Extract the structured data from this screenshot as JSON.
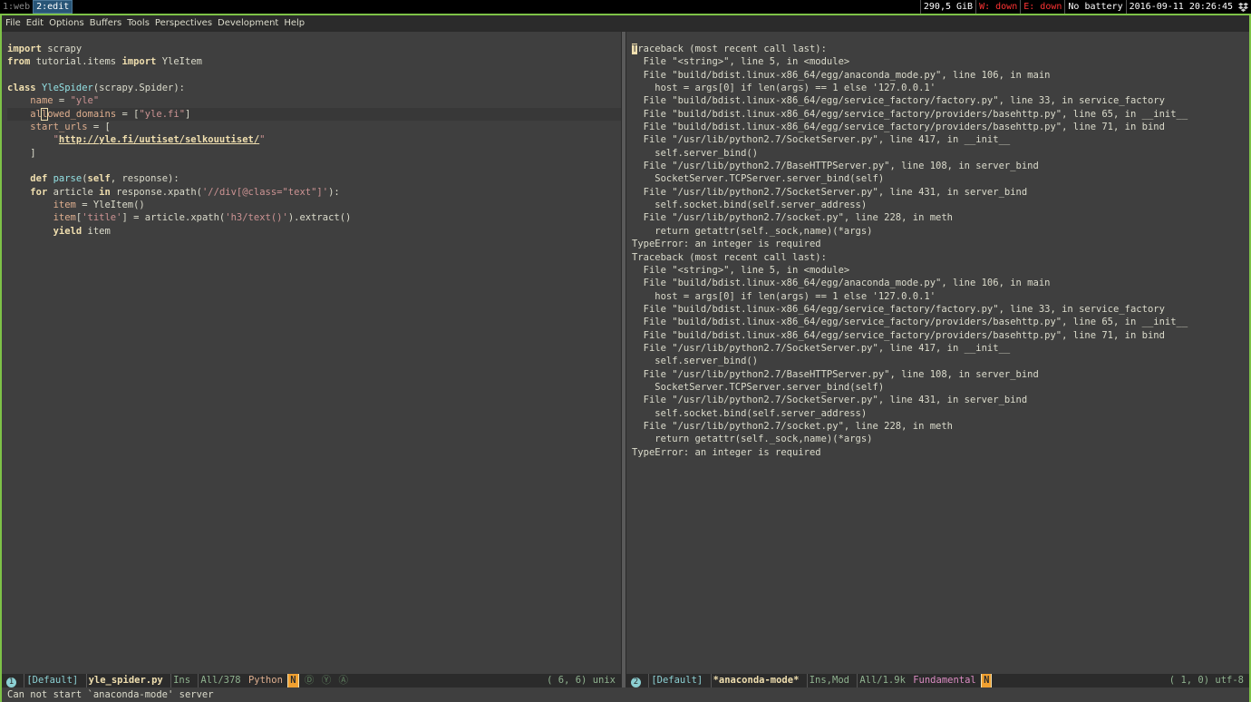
{
  "topbar": {
    "workspaces": [
      {
        "label": "1:web",
        "active": false
      },
      {
        "label": "2:edit",
        "active": true
      }
    ],
    "disk": "290,5 GiB",
    "wireless": "W: down",
    "ethernet": "E: down",
    "battery": "No battery",
    "datetime": "2016-09-11 20:26:45",
    "tray_icon": "dropbox-icon"
  },
  "menubar": {
    "items": [
      "File",
      "Edit",
      "Options",
      "Buffers",
      "Tools",
      "Perspectives",
      "Development",
      "Help"
    ]
  },
  "left_buffer": {
    "lines": [
      [
        {
          "t": "import",
          "c": "kw"
        },
        {
          "t": " scrapy"
        }
      ],
      [
        {
          "t": "from",
          "c": "kw"
        },
        {
          "t": " tutorial.items "
        },
        {
          "t": "import",
          "c": "kw"
        },
        {
          "t": " YleItem"
        }
      ],
      [
        {
          "t": ""
        }
      ],
      [
        {
          "t": "class",
          "c": "kw"
        },
        {
          "t": " "
        },
        {
          "t": "YleSpider",
          "c": "fn"
        },
        {
          "t": "(scrapy.Spider):"
        }
      ],
      [
        {
          "t": "    "
        },
        {
          "t": "name",
          "c": "var"
        },
        {
          "t": " = "
        },
        {
          "t": "\"yle\"",
          "c": "str"
        }
      ],
      [
        {
          "t": "    "
        },
        {
          "t": "al",
          "c": "var"
        },
        {
          "t": "l",
          "c": "var cursor"
        },
        {
          "t": "owed_domains",
          "c": "var"
        },
        {
          "t": " = ["
        },
        {
          "t": "\"yle.fi\"",
          "c": "str"
        },
        {
          "t": "]"
        }
      ],
      [
        {
          "t": "    "
        },
        {
          "t": "start_urls",
          "c": "var"
        },
        {
          "t": " = ["
        }
      ],
      [
        {
          "t": "        "
        },
        {
          "t": "\"",
          "c": "str"
        },
        {
          "t": "http://yle.fi/uutiset/selkouutiset/",
          "c": "url"
        },
        {
          "t": "\"",
          "c": "str"
        }
      ],
      [
        {
          "t": "    ]"
        }
      ],
      [
        {
          "t": ""
        }
      ],
      [
        {
          "t": "    "
        },
        {
          "t": "def",
          "c": "kw"
        },
        {
          "t": " "
        },
        {
          "t": "parse",
          "c": "fn"
        },
        {
          "t": "("
        },
        {
          "t": "self",
          "c": "self"
        },
        {
          "t": ", response):"
        }
      ],
      [
        {
          "t": "    "
        },
        {
          "t": "for",
          "c": "kw"
        },
        {
          "t": " article "
        },
        {
          "t": "in",
          "c": "kw"
        },
        {
          "t": " response.xpath("
        },
        {
          "t": "'//div[@class=\"text\"]'",
          "c": "str"
        },
        {
          "t": "):"
        }
      ],
      [
        {
          "t": "        "
        },
        {
          "t": "item",
          "c": "var"
        },
        {
          "t": " = YleItem()"
        }
      ],
      [
        {
          "t": "        "
        },
        {
          "t": "item",
          "c": "var"
        },
        {
          "t": "["
        },
        {
          "t": "'title'",
          "c": "str"
        },
        {
          "t": "] = article.xpath("
        },
        {
          "t": "'h3/text()'",
          "c": "str"
        },
        {
          "t": ").extract()"
        }
      ],
      [
        {
          "t": "        "
        },
        {
          "t": "yield",
          "c": "kw"
        },
        {
          "t": " item"
        }
      ]
    ],
    "highlight_line": 5
  },
  "right_buffer": {
    "lines": [
      "Traceback (most recent call last):",
      "  File \"<string>\", line 5, in <module>",
      "  File \"build/bdist.linux-x86_64/egg/anaconda_mode.py\", line 106, in main",
      "    host = args[0] if len(args) == 1 else '127.0.0.1'",
      "  File \"build/bdist.linux-x86_64/egg/service_factory/factory.py\", line 33, in service_factory",
      "  File \"build/bdist.linux-x86_64/egg/service_factory/providers/basehttp.py\", line 65, in __init__",
      "  File \"build/bdist.linux-x86_64/egg/service_factory/providers/basehttp.py\", line 71, in bind",
      "  File \"/usr/lib/python2.7/SocketServer.py\", line 417, in __init__",
      "    self.server_bind()",
      "  File \"/usr/lib/python2.7/BaseHTTPServer.py\", line 108, in server_bind",
      "    SocketServer.TCPServer.server_bind(self)",
      "  File \"/usr/lib/python2.7/SocketServer.py\", line 431, in server_bind",
      "    self.socket.bind(self.server_address)",
      "  File \"/usr/lib/python2.7/socket.py\", line 228, in meth",
      "    return getattr(self._sock,name)(*args)",
      "TypeError: an integer is required",
      "Traceback (most recent call last):",
      "  File \"<string>\", line 5, in <module>",
      "  File \"build/bdist.linux-x86_64/egg/anaconda_mode.py\", line 106, in main",
      "    host = args[0] if len(args) == 1 else '127.0.0.1'",
      "  File \"build/bdist.linux-x86_64/egg/service_factory/factory.py\", line 33, in service_factory",
      "  File \"build/bdist.linux-x86_64/egg/service_factory/providers/basehttp.py\", line 65, in __init__",
      "  File \"build/bdist.linux-x86_64/egg/service_factory/providers/basehttp.py\", line 71, in bind",
      "  File \"/usr/lib/python2.7/SocketServer.py\", line 417, in __init__",
      "    self.server_bind()",
      "  File \"/usr/lib/python2.7/BaseHTTPServer.py\", line 108, in server_bind",
      "    SocketServer.TCPServer.server_bind(self)",
      "  File \"/usr/lib/python2.7/SocketServer.py\", line 431, in server_bind",
      "    self.socket.bind(self.server_address)",
      "  File \"/usr/lib/python2.7/socket.py\", line 228, in meth",
      "    return getattr(self._sock,name)(*args)",
      "TypeError: an integer is required"
    ]
  },
  "modeline_left": {
    "window_number": "1",
    "perspective": "[Default]",
    "buffer_name": "yle_spider.py",
    "state": "Ins",
    "size": "All/378",
    "major_mode": "Python",
    "minor_indicator": "N",
    "minor_icons": [
      "Ⓓ",
      "Ⓨ",
      "Ⓐ"
    ],
    "position": "( 6, 6)",
    "encoding": "unix"
  },
  "modeline_right": {
    "window_number": "2",
    "perspective": "[Default]",
    "buffer_name": "*anaconda-mode*",
    "state": "Ins,Mod",
    "size": "All/1.9k",
    "major_mode": "Fundamental",
    "minor_indicator": "N",
    "position": "( 1, 0)",
    "encoding": "utf-8"
  },
  "echo_area": {
    "message": "Can not start `anaconda-mode' server"
  },
  "colors": {
    "background": "#3f3f3f",
    "frame_border": "#7ec247",
    "keyword": "#f0dfaf",
    "string": "#cc9393",
    "function": "#93e0e3"
  }
}
